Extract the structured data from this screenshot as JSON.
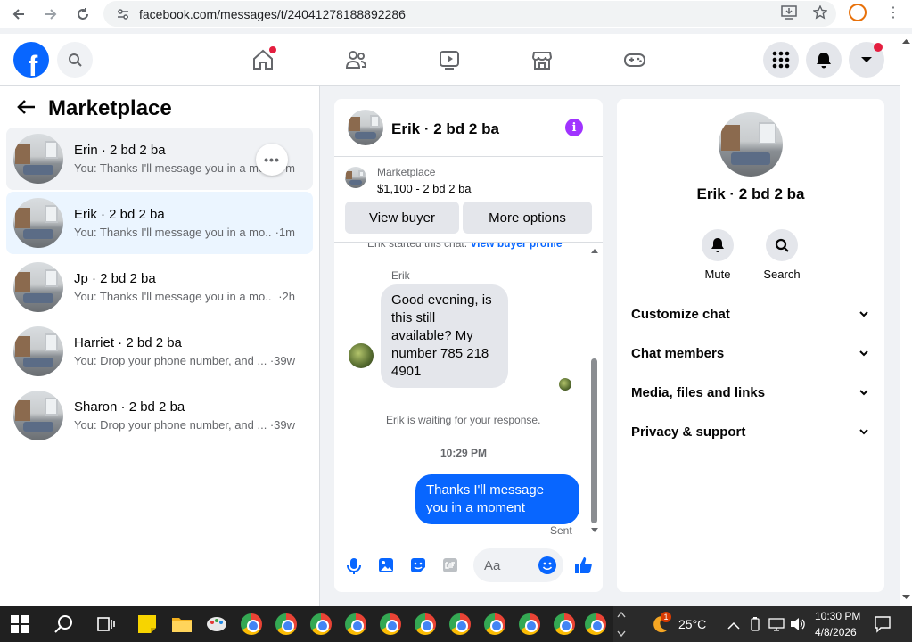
{
  "browser": {
    "url": "facebook.com/messages/t/24041278188892286"
  },
  "left_panel": {
    "title": "Marketplace",
    "conversations": [
      {
        "name": "Erin · 2 bd 2 ba",
        "preview": "You: Thanks I'll message you in a mo",
        "time": "m"
      },
      {
        "name": "Erik · 2 bd 2 ba",
        "preview": "You: Thanks I'll message you in a mo...",
        "time": "·1m"
      },
      {
        "name": "Jp · 2 bd 2 ba",
        "preview": "You: Thanks I'll message you in a mo...",
        "time": "·2h"
      },
      {
        "name": "Harriet · 2 bd 2 ba",
        "preview": "You: Drop your phone number, and ...",
        "time": "·39w"
      },
      {
        "name": "Sharon · 2 bd 2 ba",
        "preview": "You: Drop your phone number, and ...",
        "time": "·39w"
      }
    ]
  },
  "chat": {
    "title": "Erik · 2 bd 2 ba",
    "listing_source": "Marketplace",
    "listing_price": "$1,100 - 2 bd 2 ba",
    "view_buyer_label": "View buyer",
    "more_options_label": "More options",
    "started_text": "Erik started this chat.",
    "view_buyer_profile": "View buyer profile",
    "sender_name": "Erik",
    "incoming_message": "Good evening, is this still available? My number 785 218 4901",
    "waiting_text": "Erik is waiting for your response.",
    "timestamp": "10:29 PM",
    "outgoing_message": "Thanks I'll message you in a moment",
    "sent_status": "Sent",
    "input_placeholder": "Aa"
  },
  "right_panel": {
    "name": "Erik · 2 bd 2 ba",
    "actions": [
      {
        "label": "Mute",
        "icon": "bell-icon"
      },
      {
        "label": "Search",
        "icon": "search-icon"
      }
    ],
    "sections": [
      "Customize chat",
      "Chat members",
      "Media, files and links",
      "Privacy & support"
    ]
  },
  "taskbar": {
    "temperature": "25°C",
    "time": "10:30 PM",
    "date": "4/8/2026",
    "weather_badge": "1"
  },
  "colors": {
    "fb_blue": "#0866ff",
    "notification_red": "#e41e3f",
    "info_purple": "#a033ff",
    "active_row": "#ebf5ff"
  }
}
